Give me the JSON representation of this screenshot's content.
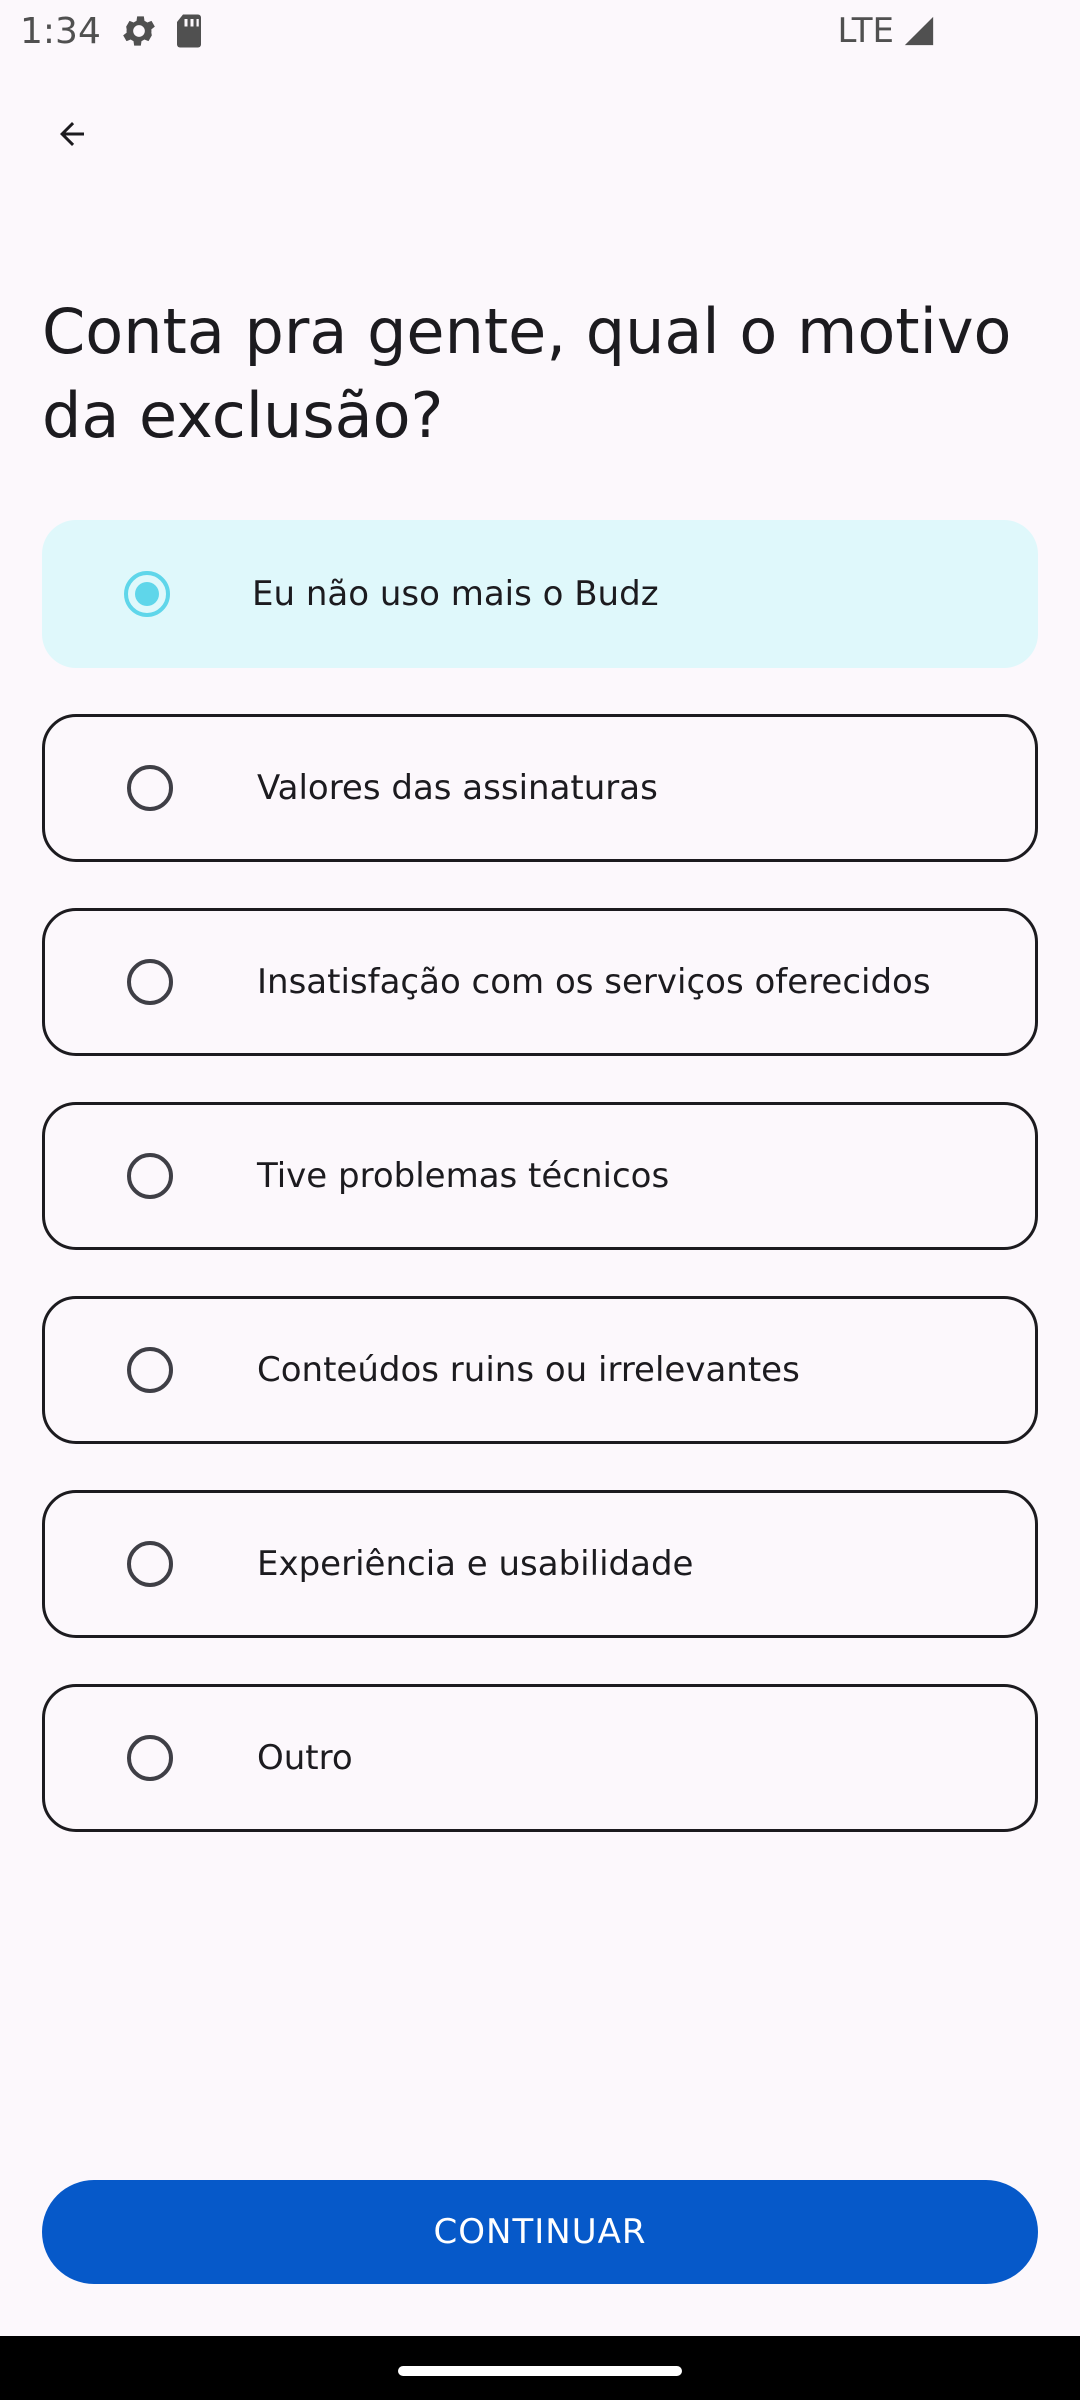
{
  "status_bar": {
    "time": "1:34",
    "network": "LTE"
  },
  "header": {
    "title": "Conta pra gente, qual o motivo da exclusão?"
  },
  "options": [
    {
      "label": "Eu não uso mais o Budz",
      "selected": true
    },
    {
      "label": "Valores das assinaturas",
      "selected": false
    },
    {
      "label": "Insatisfação com os serviços oferecidos",
      "selected": false
    },
    {
      "label": "Tive problemas técnicos",
      "selected": false
    },
    {
      "label": "Conteúdos ruins ou irrelevantes",
      "selected": false
    },
    {
      "label": "Experiência e usabilidade",
      "selected": false
    },
    {
      "label": "Outro",
      "selected": false
    }
  ],
  "actions": {
    "continue_label": "CONTINUAR"
  },
  "colors": {
    "primary": "#0659c9",
    "selected_background": "#dff8fb",
    "radio_selected": "#5fd6ea",
    "background": "#fcf8fc"
  },
  "icons": {
    "back": "arrow-back-icon",
    "settings": "gear-icon",
    "sd_card": "sd-card-icon",
    "signal": "signal-icon"
  }
}
